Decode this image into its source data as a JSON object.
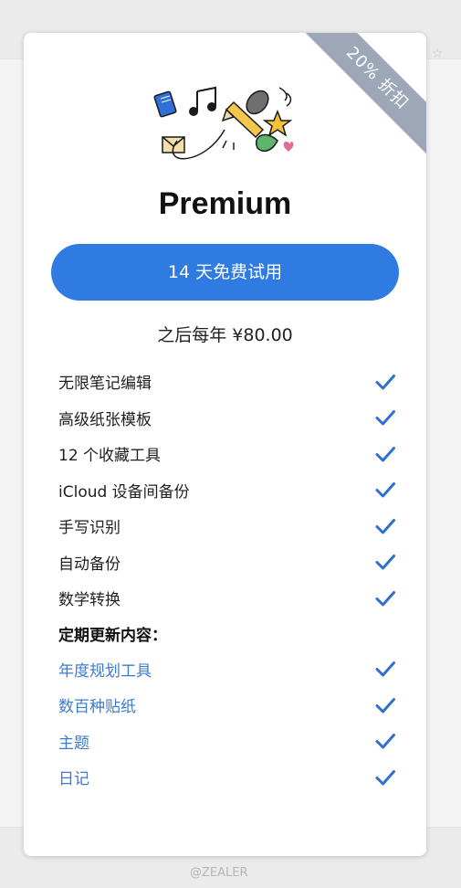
{
  "card": {
    "badge": "20% 折扣",
    "title": "Premium",
    "trial_button": "14 天免费试用",
    "price_note": "之后每年 ¥80.00"
  },
  "features": [
    {
      "label": "无限笔记编辑",
      "included": true
    },
    {
      "label": "高级纸张模板",
      "included": true
    },
    {
      "label": "12 个收藏工具",
      "included": true
    },
    {
      "label": "iCloud 设备间备份",
      "included": true
    },
    {
      "label": "手写识别",
      "included": true
    },
    {
      "label": "自动备份",
      "included": true
    },
    {
      "label": "数学转换",
      "included": true
    }
  ],
  "upcoming": {
    "heading": "定期更新内容：",
    "items": [
      {
        "label": "年度规划工具",
        "included": true
      },
      {
        "label": "数百种贴纸",
        "included": true
      },
      {
        "label": "主题",
        "included": true
      },
      {
        "label": "日记",
        "included": true
      }
    ]
  },
  "watermark": "@ZEALER",
  "colors": {
    "accent": "#2f7be2",
    "check": "#2f6fcf",
    "upcoming_text": "#3d7bd1",
    "ribbon": "#9ea7b8"
  },
  "icons": {
    "check": "check-icon",
    "illustration": "stationery-doodle",
    "background": "star-icon"
  }
}
